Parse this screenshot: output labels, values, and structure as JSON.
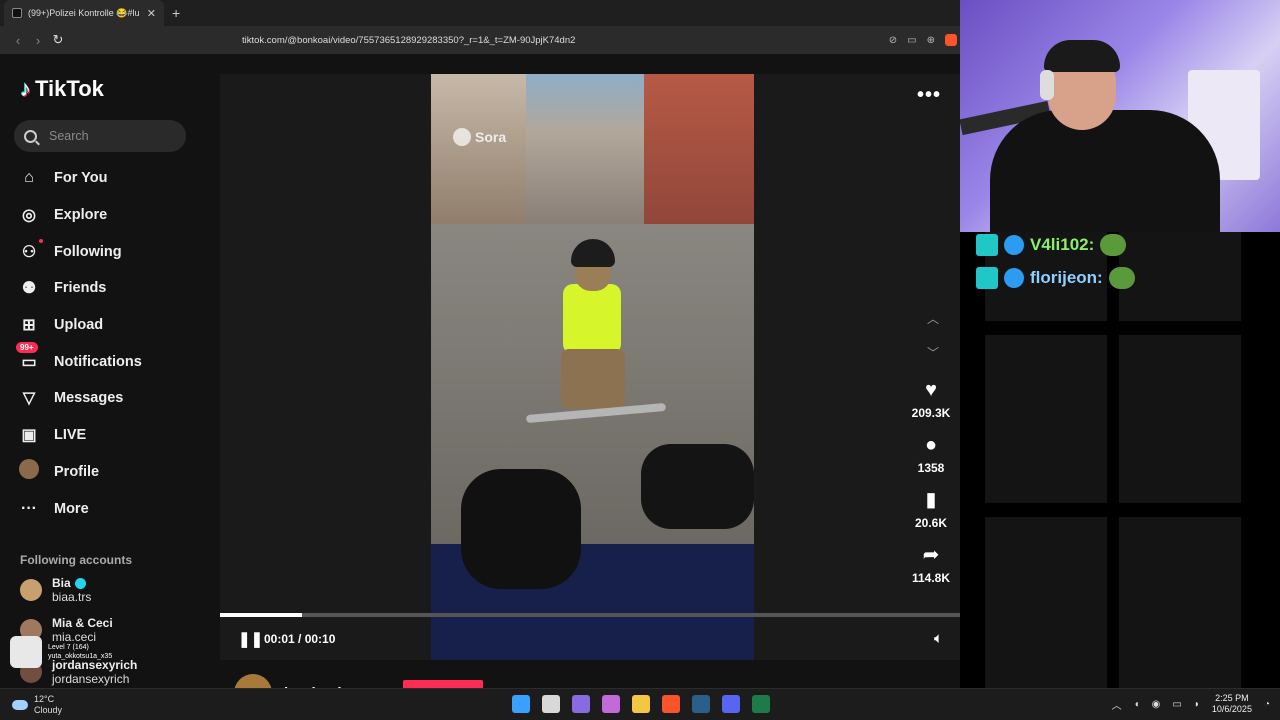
{
  "browser": {
    "tab_title": "(99+)Polizei Kontrolle 😂#lu",
    "tab_close": "✕",
    "new_tab": "+",
    "back": "‹",
    "forward": "›",
    "reload": "↻",
    "url": "tiktok.com/@bonkoai/video/7557365128929283350?_r=1&_t=ZM-90JpjK74dn2"
  },
  "tiktok": {
    "logo": "TikTok",
    "search_placeholder": "Search",
    "nav": [
      {
        "label": "For You",
        "icon": "home-icon"
      },
      {
        "label": "Explore",
        "icon": "compass-icon"
      },
      {
        "label": "Following",
        "icon": "following-icon"
      },
      {
        "label": "Friends",
        "icon": "friends-icon"
      },
      {
        "label": "Upload",
        "icon": "upload-icon"
      },
      {
        "label": "Notifications",
        "icon": "inbox-icon",
        "badge": "99+"
      },
      {
        "label": "Messages",
        "icon": "send-icon"
      },
      {
        "label": "LIVE",
        "icon": "live-icon"
      },
      {
        "label": "Profile",
        "icon": "avatar"
      },
      {
        "label": "More",
        "icon": "more-icon"
      }
    ],
    "following_title": "Following accounts",
    "following": [
      {
        "name": "Bia",
        "handle": "biaa.trs",
        "verified": true
      },
      {
        "name": "Mia & Ceci",
        "handle": "mia.ceci",
        "verified": false
      },
      {
        "name": "jordansexyrich",
        "handle": "jordansexyrich",
        "verified": false
      }
    ],
    "video": {
      "watermark": "Sora",
      "time": "00:01 / 00:10",
      "progress": 0.11,
      "more": "•••",
      "author": "bonkoai"
    },
    "actions": [
      {
        "icon": "heart-icon",
        "count": "209.3K"
      },
      {
        "icon": "comment-icon",
        "count": "1358"
      },
      {
        "icon": "bookmark-icon",
        "count": "20.6K"
      },
      {
        "icon": "share-icon",
        "count": "114.8K"
      }
    ]
  },
  "chat": [
    {
      "user": "V4li102:",
      "color": "#8af06a"
    },
    {
      "user": "florijeon:",
      "color": "#8fd0ff"
    }
  ],
  "achievement": {
    "line1": "Level 7 (164)",
    "line2": "yuta_okkotsu1a_x35"
  },
  "taskbar": {
    "temp": "12°C",
    "condition": "Cloudy",
    "time": "2:25 PM",
    "date": "10/6/2025"
  }
}
